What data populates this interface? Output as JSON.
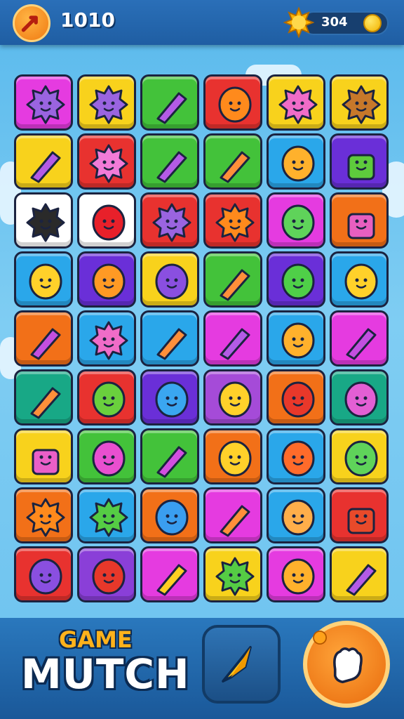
{
  "hud": {
    "score": "1010",
    "coins": "304",
    "left_button_icon": "arrow-icon",
    "sun_icon": "sun-icon",
    "coin_icon": "coin-icon"
  },
  "footer": {
    "logo_top": "GAME",
    "logo_bottom": "MUTCH",
    "center_button_icon": "dart-icon",
    "right_button_icon": "hand-icon"
  },
  "board": {
    "columns": 6,
    "rows": 9,
    "tiles": [
      [
        {
          "color": "#e53be0",
          "item": "purple-blob"
        },
        {
          "color": "#f8d21c",
          "item": "purple-blob"
        },
        {
          "color": "#43c23a",
          "item": "pencil"
        },
        {
          "color": "#e8322f",
          "item": "orange-fruit"
        },
        {
          "color": "#f8d21c",
          "item": "pink-blob"
        },
        {
          "color": "#f8d21c",
          "item": "brown-blob"
        }
      ],
      [
        {
          "color": "#f8d21c",
          "item": "pencil"
        },
        {
          "color": "#e8322f",
          "item": "pink-sun"
        },
        {
          "color": "#43c23a",
          "item": "pencil"
        },
        {
          "color": "#43c23a",
          "item": "rocket"
        },
        {
          "color": "#2aa7ea",
          "item": "orange-ball"
        },
        {
          "color": "#6a2fd8",
          "item": "green-cup"
        }
      ],
      [
        {
          "color": "#ffffff",
          "item": "black-blob"
        },
        {
          "color": "#ffffff",
          "item": "apple"
        },
        {
          "color": "#e8322f",
          "item": "purple-blob"
        },
        {
          "color": "#e8322f",
          "item": "orange-sun"
        },
        {
          "color": "#e53be0",
          "item": "green-balloon"
        },
        {
          "color": "#f27018",
          "item": "popcorn"
        }
      ],
      [
        {
          "color": "#2aa7ea",
          "item": "lemon"
        },
        {
          "color": "#6a2fd8",
          "item": "orange-crab"
        },
        {
          "color": "#f8d21c",
          "item": "purple-ball"
        },
        {
          "color": "#43c23a",
          "item": "rocket"
        },
        {
          "color": "#6a2fd8",
          "item": "green-ball"
        },
        {
          "color": "#2aa7ea",
          "item": "lemon"
        }
      ],
      [
        {
          "color": "#f27018",
          "item": "planet"
        },
        {
          "color": "#2aa7ea",
          "item": "pink-blob"
        },
        {
          "color": "#2aa7ea",
          "item": "rocket"
        },
        {
          "color": "#e53be0",
          "item": "pencil"
        },
        {
          "color": "#2aa7ea",
          "item": "orange-ball"
        },
        {
          "color": "#e53be0",
          "item": "planet"
        }
      ],
      [
        {
          "color": "#18a886",
          "item": "rocket"
        },
        {
          "color": "#e8322f",
          "item": "green-leaf"
        },
        {
          "color": "#6a2fd8",
          "item": "blue-bubble"
        },
        {
          "color": "#a54bd8",
          "item": "lemon"
        },
        {
          "color": "#f27018",
          "item": "red-ball"
        },
        {
          "color": "#18a886",
          "item": "pink-ball"
        }
      ],
      [
        {
          "color": "#f8d21c",
          "item": "pink-box"
        },
        {
          "color": "#43c23a",
          "item": "pink-fruit"
        },
        {
          "color": "#43c23a",
          "item": "pink-plane"
        },
        {
          "color": "#f27018",
          "item": "lemon"
        },
        {
          "color": "#2aa7ea",
          "item": "orange-balloon"
        },
        {
          "color": "#f8d21c",
          "item": "green-bubble"
        }
      ],
      [
        {
          "color": "#f27018",
          "item": "orange-sun"
        },
        {
          "color": "#2aa7ea",
          "item": "green-blob"
        },
        {
          "color": "#f27018",
          "item": "blue-drop"
        },
        {
          "color": "#e53be0",
          "item": "rocket"
        },
        {
          "color": "#2aa7ea",
          "item": "orange-drop"
        },
        {
          "color": "#e8322f",
          "item": "red-pot"
        }
      ],
      [
        {
          "color": "#e8322f",
          "item": "purple-ball"
        },
        {
          "color": "#8a3fd8",
          "item": "red-ball"
        },
        {
          "color": "#e53be0",
          "item": "yellow-plane"
        },
        {
          "color": "#f8d21c",
          "item": "green-blob"
        },
        {
          "color": "#e53be0",
          "item": "orange-ball"
        },
        {
          "color": "#f8d21c",
          "item": "pencil"
        }
      ]
    ]
  }
}
